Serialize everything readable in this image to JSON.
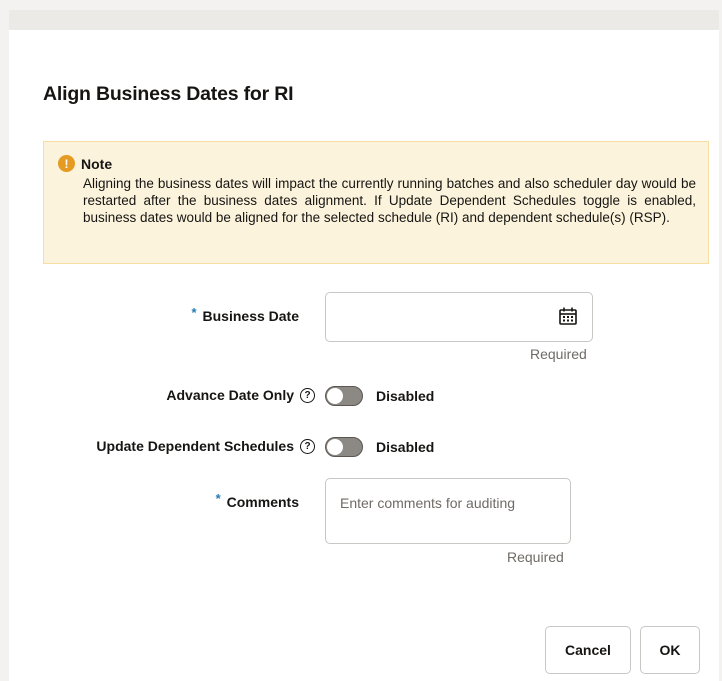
{
  "dialog": {
    "title": "Align Business Dates for RI"
  },
  "note": {
    "icon": "warning-icon",
    "heading": "Note",
    "body": "Aligning the business dates will impact the currently running batches and also scheduler day would be restarted after the business dates alignment. If Update Dependent Schedules toggle is enabled, business dates would be aligned for the selected schedule (RI) and dependent schedule(s) (RSP)."
  },
  "form": {
    "required_marker": "*",
    "business_date": {
      "label": "Business Date",
      "value": "",
      "icon": "calendar-icon",
      "hint": "Required"
    },
    "advance_date_only": {
      "label": "Advance Date Only",
      "help_icon": "help-icon",
      "state": "Disabled",
      "enabled": false
    },
    "update_dependent_schedules": {
      "label": "Update Dependent Schedules",
      "help_icon": "help-icon",
      "state": "Disabled",
      "enabled": false
    },
    "comments": {
      "label": "Comments",
      "placeholder": "Enter comments for auditing",
      "value": "",
      "hint": "Required"
    }
  },
  "actions": {
    "cancel_label": "Cancel",
    "ok_label": "OK"
  },
  "colors": {
    "note_background": "#fcf3dc",
    "warning_icon": "#e59a22",
    "required_star": "#227bb5",
    "toggle_off": "#8c8883"
  }
}
